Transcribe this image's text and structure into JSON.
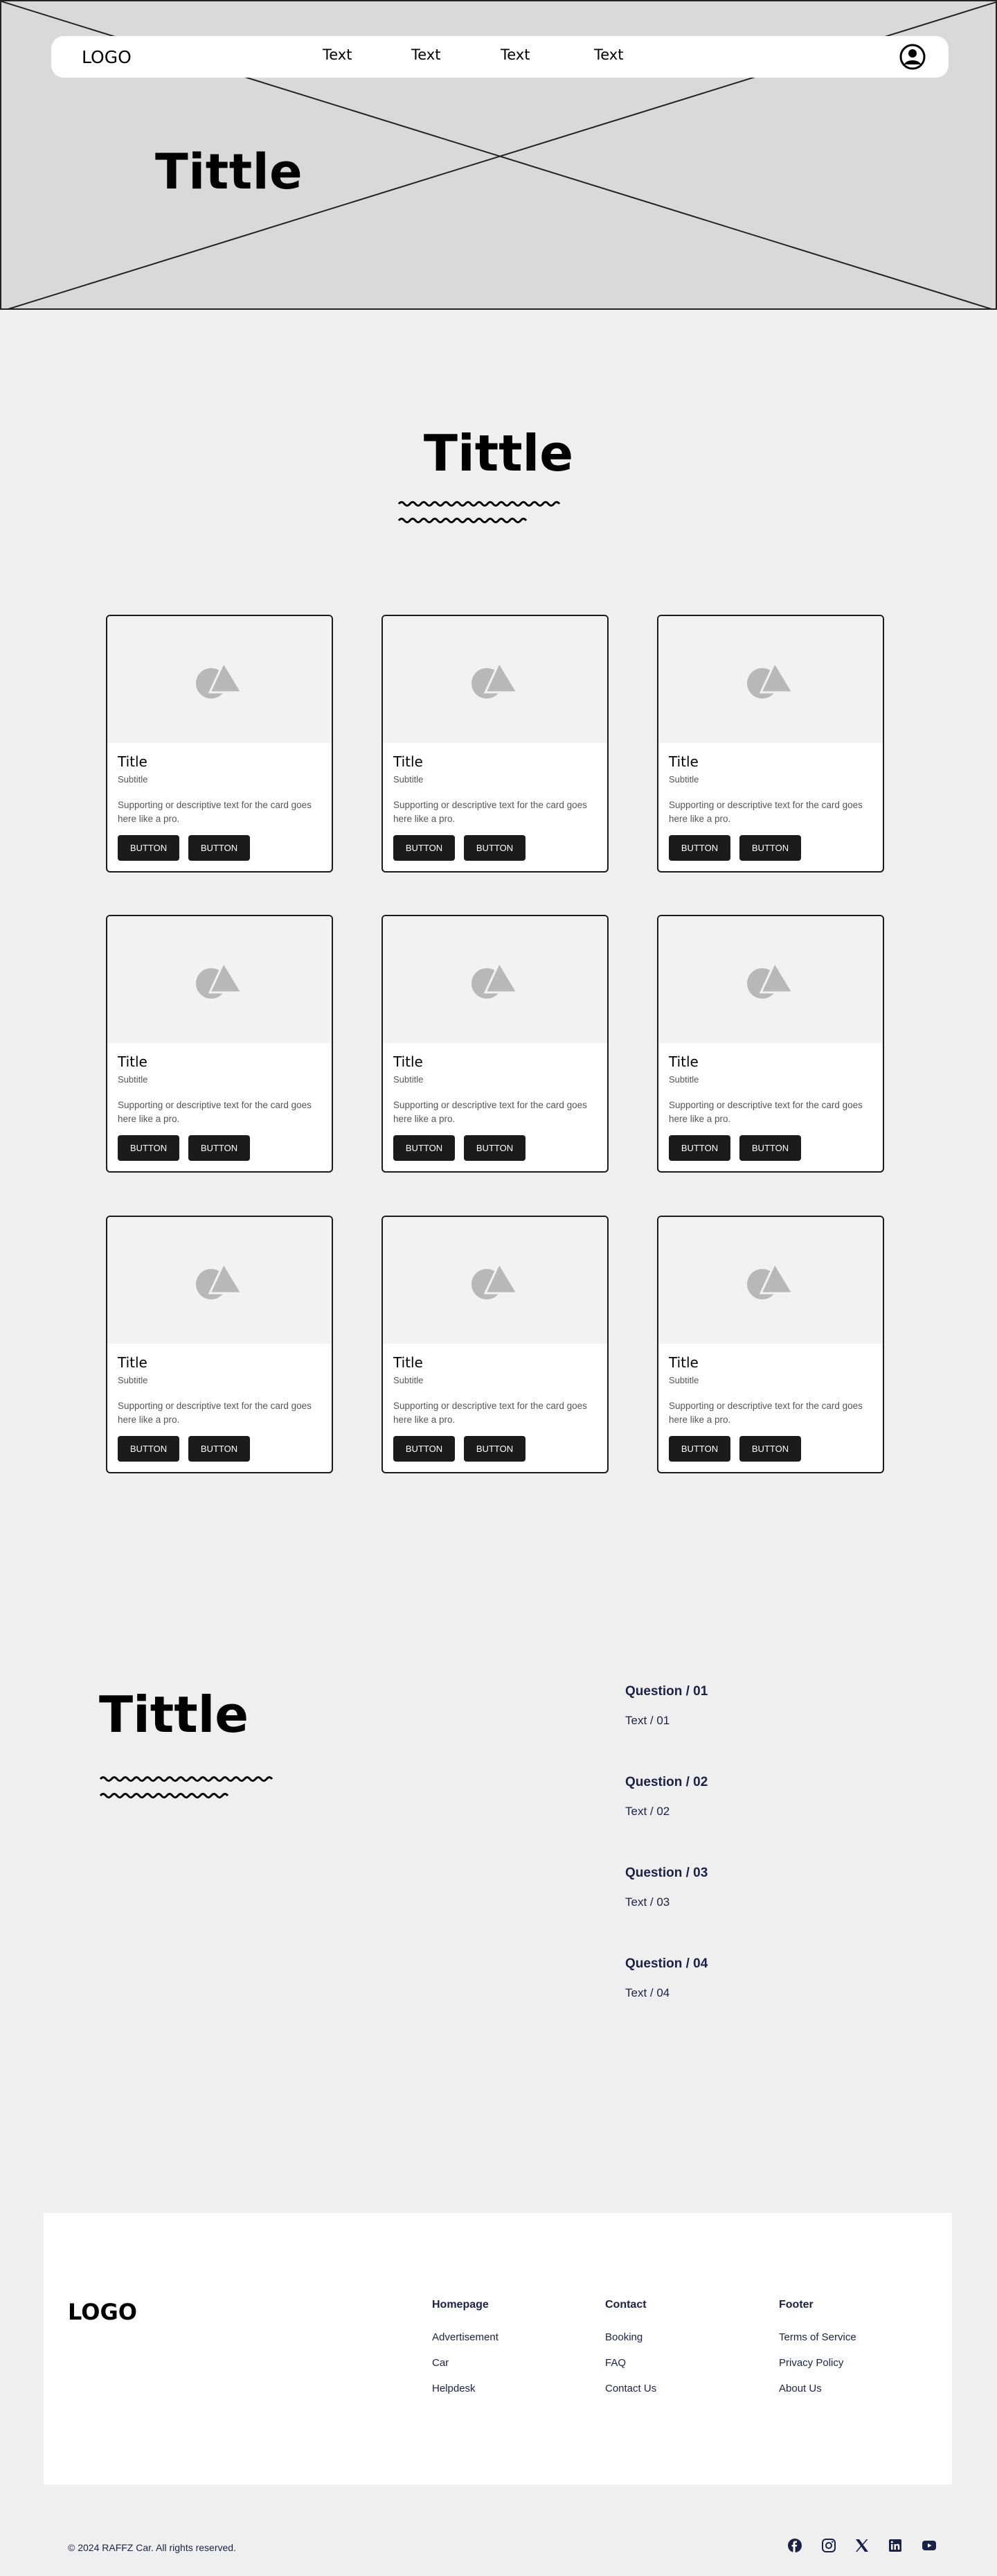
{
  "header": {
    "logo": "LOGO",
    "nav": [
      "Text",
      "Text",
      "Text",
      "Text"
    ],
    "profile_icon": "user-circle-icon"
  },
  "hero": {
    "title": "Tittle"
  },
  "cards_section": {
    "title": "Tittle",
    "cards": [
      {
        "title": "Title",
        "subtitle": "Subtitle",
        "text": "Supporting or descriptive text for the card goes here like a pro.",
        "button1": "BUTTON",
        "button2": "BUTTON",
        "image_icon": "image-placeholder-icon"
      },
      {
        "title": "Title",
        "subtitle": "Subtitle",
        "text": "Supporting or descriptive text for the card goes here like a pro.",
        "button1": "BUTTON",
        "button2": "BUTTON",
        "image_icon": "image-placeholder-icon"
      },
      {
        "title": "Title",
        "subtitle": "Subtitle",
        "text": "Supporting or descriptive text for the card goes here like a pro.",
        "button1": "BUTTON",
        "button2": "BUTTON",
        "image_icon": "image-placeholder-icon"
      },
      {
        "title": "Title",
        "subtitle": "Subtitle",
        "text": "Supporting or descriptive text for the card goes here like a pro.",
        "button1": "BUTTON",
        "button2": "BUTTON",
        "image_icon": "image-placeholder-icon"
      },
      {
        "title": "Title",
        "subtitle": "Subtitle",
        "text": "Supporting or descriptive text for the card goes here like a pro.",
        "button1": "BUTTON",
        "button2": "BUTTON",
        "image_icon": "image-placeholder-icon"
      },
      {
        "title": "Title",
        "subtitle": "Subtitle",
        "text": "Supporting or descriptive text for the card goes here like a pro.",
        "button1": "BUTTON",
        "button2": "BUTTON",
        "image_icon": "image-placeholder-icon"
      },
      {
        "title": "Title",
        "subtitle": "Subtitle",
        "text": "Supporting or descriptive text for the card goes here like a pro.",
        "button1": "BUTTON",
        "button2": "BUTTON",
        "image_icon": "image-placeholder-icon"
      },
      {
        "title": "Title",
        "subtitle": "Subtitle",
        "text": "Supporting or descriptive text for the card goes here like a pro.",
        "button1": "BUTTON",
        "button2": "BUTTON",
        "image_icon": "image-placeholder-icon"
      },
      {
        "title": "Title",
        "subtitle": "Subtitle",
        "text": "Supporting or descriptive text for the card goes here like a pro.",
        "button1": "BUTTON",
        "button2": "BUTTON",
        "image_icon": "image-placeholder-icon"
      }
    ]
  },
  "faq": {
    "title": "Tittle",
    "items": [
      {
        "question": "Question / 01",
        "answer": "Text / 01"
      },
      {
        "question": "Question / 02",
        "answer": "Text / 02"
      },
      {
        "question": "Question / 03",
        "answer": "Text / 03"
      },
      {
        "question": "Question / 04",
        "answer": "Text / 04"
      }
    ]
  },
  "footer": {
    "logo": "LOGO",
    "columns": [
      {
        "heading": "Homepage",
        "links": [
          "Advertisement",
          "Car",
          "Helpdesk"
        ]
      },
      {
        "heading": "Contact",
        "links": [
          "Booking",
          "FAQ",
          "Contact Us"
        ]
      },
      {
        "heading": "Footer",
        "links": [
          "Terms of Service",
          "Privacy Policy",
          "About Us"
        ]
      }
    ],
    "copyright": "© 2024 RAFFZ Car. All rights reserved.",
    "social": [
      "facebook-icon",
      "instagram-icon",
      "x-icon",
      "linkedin-icon",
      "youtube-icon"
    ]
  },
  "colors": {
    "accent_text": "#1a2247",
    "button_bg": "#1b1b1b",
    "hero_bg": "#d9d9db",
    "page_bg": "#efefef"
  }
}
